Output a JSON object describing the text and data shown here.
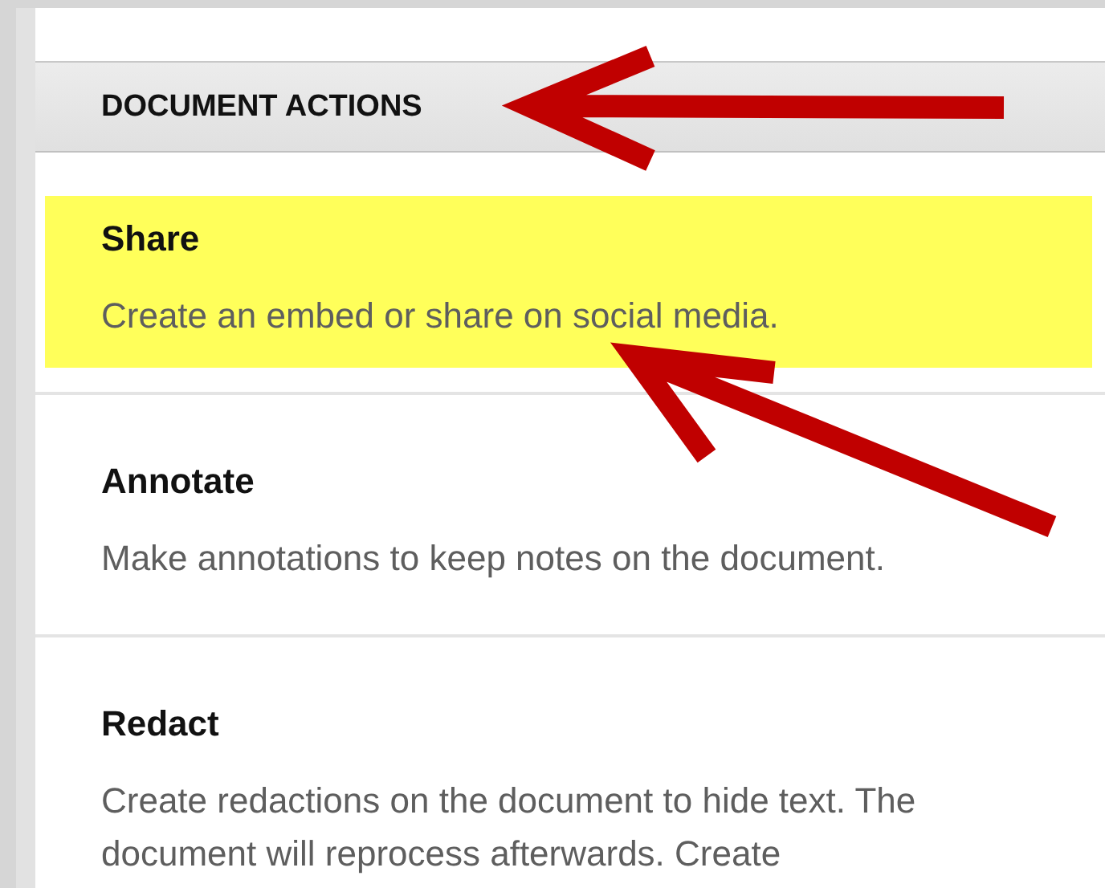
{
  "panel": {
    "header": "DOCUMENT ACTIONS",
    "actions": [
      {
        "title": "Share",
        "description": "Create an embed or share on social media.",
        "highlighted": true
      },
      {
        "title": "Annotate",
        "description": "Make annotations to keep notes on the document.",
        "highlighted": false
      },
      {
        "title": "Redact",
        "description": "Create redactions on the document to hide text. The document will reprocess afterwards. Create",
        "highlighted": false
      }
    ]
  }
}
